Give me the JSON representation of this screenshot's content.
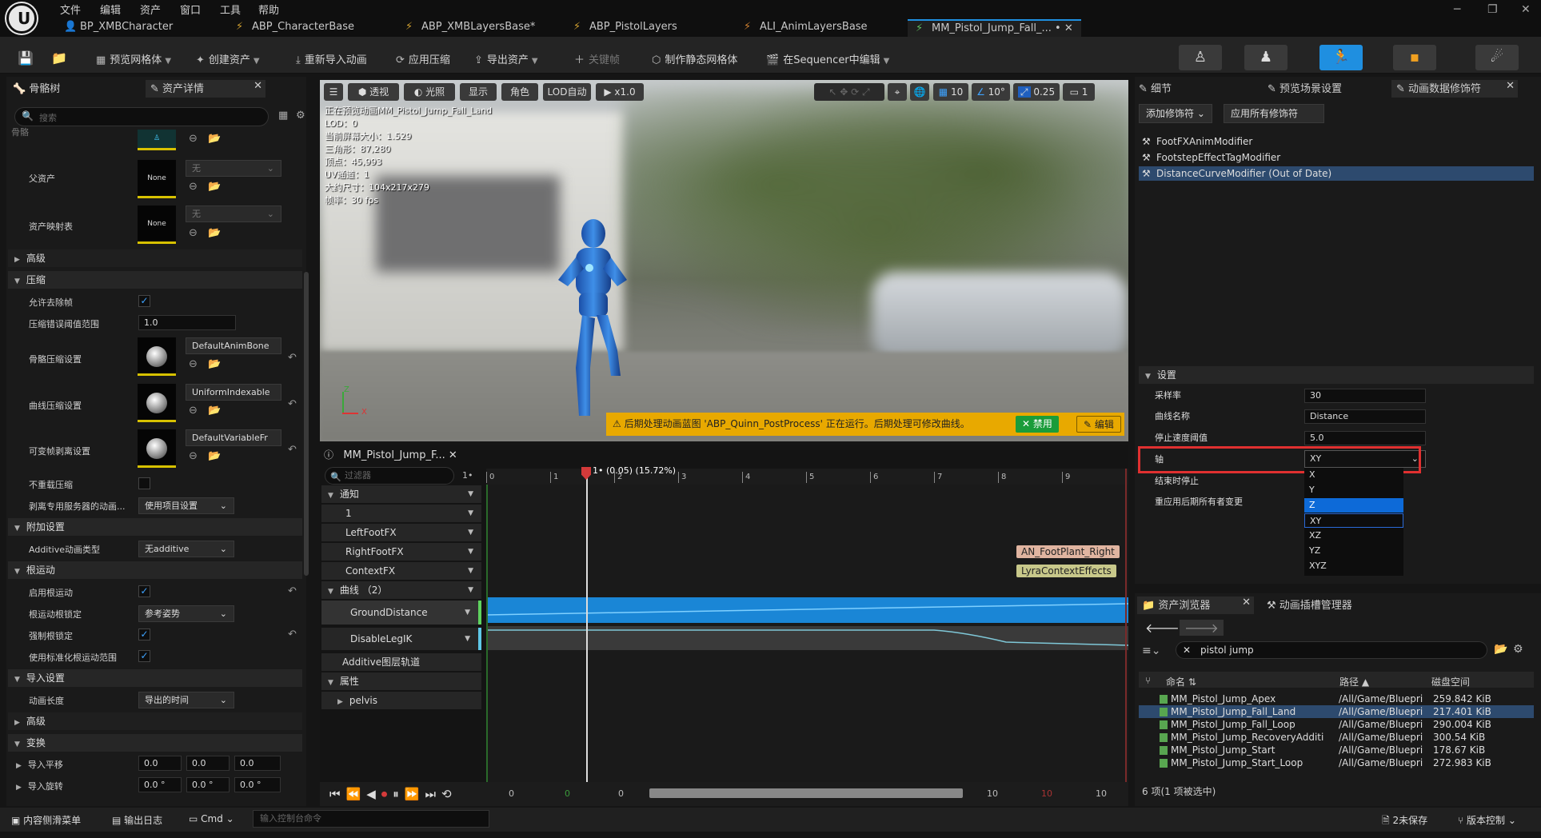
{
  "menu": [
    "文件",
    "编辑",
    "资产",
    "窗口",
    "工具",
    "帮助"
  ],
  "doc_tabs": [
    "BP_XMBCharacter",
    "ABP_CharacterBase",
    "ABP_XMBLayersBase*",
    "ABP_PistolLayers",
    "ALI_AnimLayersBase",
    "MM_Pistol_Jump_Fall_..."
  ],
  "doc_tab_dirty_mark": "•",
  "toolbar": {
    "preview_mesh": "预览网格体",
    "create_asset": "创建资产",
    "reimport": "重新导入动画",
    "apply_compression": "应用压缩",
    "export_asset": "导出资产",
    "keyframe": "关键帧",
    "make_static_mesh": "制作静态网格体",
    "edit_in_sequencer": "在Sequencer中编辑"
  },
  "left_tabs": {
    "skeleton_tree": "骨骼树",
    "asset_details": "资产详情"
  },
  "left_search_placeholder": "搜索",
  "left_panel": {
    "truncated_label": "骨骼",
    "parent_asset": "父资产",
    "parent_none": "None",
    "parent_dropdown": "无",
    "asset_mapping": "资产映射表",
    "mapping_none": "None",
    "mapping_dropdown": "无",
    "advanced": "高级",
    "compression_section": "压缩",
    "allow_strip": "允许去除帧",
    "error_threshold": "压缩错误阈值范围",
    "error_threshold_value": "1.0",
    "bone_compression": "骨骼压缩设置",
    "bone_compression_value": "DefaultAnimBone",
    "curve_compression": "曲线压缩设置",
    "curve_compression_value": "UniformIndexable",
    "variable_frame": "可变帧剥离设置",
    "variable_frame_value": "DefaultVariableFr",
    "no_compress": "不重载压缩",
    "strip_server": "剥离专用服务器的动画...",
    "strip_server_value": "使用项目设置",
    "additive_section": "附加设置",
    "additive_type": "Additive动画类型",
    "additive_type_value": "无additive",
    "root_motion_section": "根运动",
    "enable_root_motion": "启用根运动",
    "root_motion_lock": "根运动根锁定",
    "root_motion_lock_value": "参考姿势",
    "force_root_lock": "强制根锁定",
    "use_normalized": "使用标准化根运动范围",
    "import_section": "导入设置",
    "anim_length": "动画长度",
    "anim_length_value": "导出的时间",
    "advanced2": "高级",
    "transform_section": "变换",
    "import_translation": "导入平移",
    "import_rotation": "导入旋转",
    "translation_values": [
      "0.0",
      "0.0",
      "0.0"
    ],
    "rotation_values": [
      "0.0 °",
      "0.0 °",
      "0.0 °"
    ]
  },
  "viewport": {
    "perspective": "透视",
    "lighting": "光照",
    "show": "显示",
    "character": "角色",
    "lod": "LOD自动",
    "speed": "x1.0",
    "grid": "10",
    "angle": "10°",
    "scale": "0.25",
    "camera": "1",
    "info": [
      "正在预览动画MM_Pistol_Jump_Fall_Land",
      "LOD：0",
      "当前屏幕大小：1.529",
      "三角形：87,280",
      "顶点：45,993",
      "UV通道：1",
      "大约尺寸：104x217x279",
      "帧率：30 fps"
    ],
    "axis_z": "Z",
    "axis_x": "X",
    "warning": "后期处理动画蓝图 'ABP_Quinn_PostProcess' 正在运行。后期处理可修改曲线。",
    "disable_btn": "禁用",
    "edit_btn": "编辑"
  },
  "timeline": {
    "tab": "MM_Pistol_Jump_F...",
    "filter_placeholder": "过滤器",
    "filter_count": "1•",
    "tracks": [
      "通知",
      "1",
      "LeftFootFX",
      "RightFootFX",
      "ContextFX",
      "曲线 （2）",
      "GroundDistance",
      "DisableLegIK",
      "Additive图层轨道",
      "属性",
      "pelvis"
    ],
    "playhead_label": "1• (0.05) (15.72%)",
    "ruler_ticks": [
      "0",
      "1",
      "2",
      "3",
      "4",
      "5",
      "6",
      "7",
      "8",
      "9"
    ],
    "notify_right": "AN_FootPlant_Right",
    "notify_context": "LyraContextEffects",
    "transport_left": "0",
    "transport_g": "0",
    "transport_c": "0",
    "transport_r1": "10",
    "transport_r2": "10",
    "transport_r3": "10"
  },
  "right_tabs": {
    "details": "细节",
    "preview_scene": "预览场景设置",
    "anim_modifiers": "动画数据修饰符"
  },
  "right_panel": {
    "add_modifier": "添加修饰符",
    "apply_all": "应用所有修饰符",
    "modifiers": [
      "FootFXAnimModifier",
      "FootstepEffectTagModifier",
      "DistanceCurveModifier (Out of Date)"
    ],
    "settings_section": "设置",
    "sample_rate": "采样率",
    "sample_rate_value": "30",
    "curve_name": "曲线名称",
    "curve_name_value": "Distance",
    "stop_threshold": "停止速度阈值",
    "stop_threshold_value": "5.0",
    "axis": "轴",
    "axis_value": "XY",
    "stop_at_end": "结束时停止",
    "reapply": "重应用后期所有者变更",
    "axis_options": [
      "X",
      "Y",
      "Z",
      "XY",
      "XZ",
      "YZ",
      "XYZ"
    ],
    "highlighted_option": "Z"
  },
  "asset_browser": {
    "tab": "资产浏览器",
    "tab2": "动画插槽管理器",
    "search_value": "pistol jump",
    "col_name": "命名",
    "col_path": "路径",
    "col_size": "磁盘空间",
    "rows": [
      {
        "name": "MM_Pistol_Jump_Apex",
        "path": "/All/Game/Bluepri",
        "size": "259.842 KiB"
      },
      {
        "name": "MM_Pistol_Jump_Fall_Land",
        "path": "/All/Game/Bluepri",
        "size": "217.401 KiB"
      },
      {
        "name": "MM_Pistol_Jump_Fall_Loop",
        "path": "/All/Game/Bluepri",
        "size": "290.004 KiB"
      },
      {
        "name": "MM_Pistol_Jump_RecoveryAdditi",
        "path": "/All/Game/Bluepri",
        "size": "300.54 KiB"
      },
      {
        "name": "MM_Pistol_Jump_Start",
        "path": "/All/Game/Bluepri",
        "size": "178.67 KiB"
      },
      {
        "name": "MM_Pistol_Jump_Start_Loop",
        "path": "/All/Game/Bluepri",
        "size": "272.983 KiB"
      }
    ],
    "footer": "6 项(1 项被选中)"
  },
  "status_bar": {
    "content_drawer": "内容侧滑菜单",
    "output_log": "输出日志",
    "cmd": "Cmd",
    "console_placeholder": "输入控制台命令",
    "unsaved": "2未保存",
    "source_control": "版本控制"
  },
  "colors": {
    "accent": "#1f8fe0",
    "selection": "#0d6ad8",
    "warning": "#e8a900",
    "curve_blue": "#1a86d6",
    "highlight_red": "#e03030"
  }
}
